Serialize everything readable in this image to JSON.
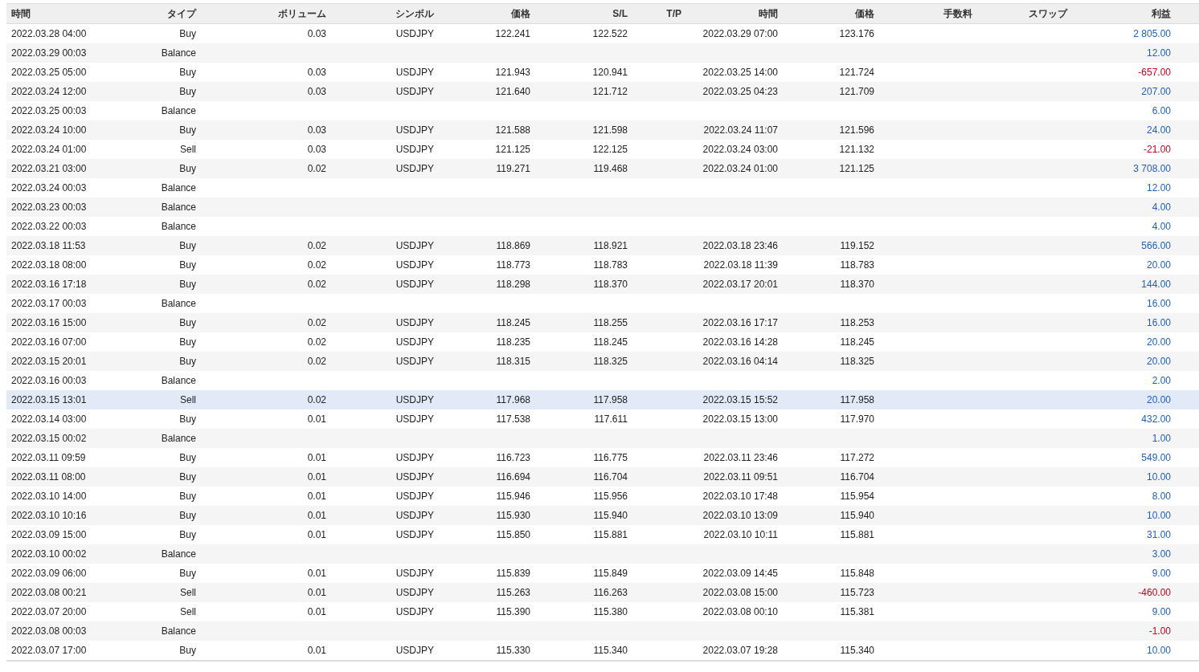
{
  "table": {
    "columns": [
      "時間",
      "タイプ",
      "ボリューム",
      "シンボル",
      "価格",
      "S/L",
      "T/P",
      "時間",
      "価格",
      "手数料",
      "スワップ",
      "利益"
    ],
    "rows": [
      {
        "time": "2022.03.28 04:00",
        "type": "Buy",
        "volume": "0.03",
        "symbol": "USDJPY",
        "price": "122.241",
        "sl": "122.522",
        "close_time": "2022.03.29 07:00",
        "close_price": "123.176",
        "profit": "2 805.00",
        "color": "#1f5fbf",
        "selected": false
      },
      {
        "time": "2022.03.29 00:03",
        "type": "Balance",
        "profit": "12.00",
        "color": "#1f5fbf",
        "selected": false
      },
      {
        "time": "2022.03.25 05:00",
        "type": "Buy",
        "volume": "0.03",
        "symbol": "USDJPY",
        "price": "121.943",
        "sl": "120.941",
        "close_time": "2022.03.25 14:00",
        "close_price": "121.724",
        "profit": "-657.00",
        "color": "#c8001e",
        "selected": false
      },
      {
        "time": "2022.03.24 12:00",
        "type": "Buy",
        "volume": "0.03",
        "symbol": "USDJPY",
        "price": "121.640",
        "sl": "121.712",
        "close_time": "2022.03.25 04:23",
        "close_price": "121.709",
        "profit": "207.00",
        "color": "#1f5fbf",
        "selected": false
      },
      {
        "time": "2022.03.25 00:03",
        "type": "Balance",
        "profit": "6.00",
        "color": "#1f5fbf",
        "selected": false
      },
      {
        "time": "2022.03.24 10:00",
        "type": "Buy",
        "volume": "0.03",
        "symbol": "USDJPY",
        "price": "121.588",
        "sl": "121.598",
        "close_time": "2022.03.24 11:07",
        "close_price": "121.596",
        "profit": "24.00",
        "color": "#1f5fbf",
        "selected": false
      },
      {
        "time": "2022.03.24 01:00",
        "type": "Sell",
        "volume": "0.03",
        "symbol": "USDJPY",
        "price": "121.125",
        "sl": "122.125",
        "close_time": "2022.03.24 03:00",
        "close_price": "121.132",
        "profit": "-21.00",
        "color": "#c8001e",
        "selected": false
      },
      {
        "time": "2022.03.21 03:00",
        "type": "Buy",
        "volume": "0.02",
        "symbol": "USDJPY",
        "price": "119.271",
        "sl": "119.468",
        "close_time": "2022.03.24 01:00",
        "close_price": "121.125",
        "profit": "3 708.00",
        "color": "#1f5fbf",
        "selected": false
      },
      {
        "time": "2022.03.24 00:03",
        "type": "Balance",
        "profit": "12.00",
        "color": "#1f5fbf",
        "selected": false
      },
      {
        "time": "2022.03.23 00:03",
        "type": "Balance",
        "profit": "4.00",
        "color": "#1f5fbf",
        "selected": false
      },
      {
        "time": "2022.03.22 00:03",
        "type": "Balance",
        "profit": "4.00",
        "color": "#1f5fbf",
        "selected": false
      },
      {
        "time": "2022.03.18 11:53",
        "type": "Buy",
        "volume": "0.02",
        "symbol": "USDJPY",
        "price": "118.869",
        "sl": "118.921",
        "close_time": "2022.03.18 23:46",
        "close_price": "119.152",
        "profit": "566.00",
        "color": "#1f5fbf",
        "selected": false
      },
      {
        "time": "2022.03.18 08:00",
        "type": "Buy",
        "volume": "0.02",
        "symbol": "USDJPY",
        "price": "118.773",
        "sl": "118.783",
        "close_time": "2022.03.18 11:39",
        "close_price": "118.783",
        "profit": "20.00",
        "color": "#1f5fbf",
        "selected": false
      },
      {
        "time": "2022.03.16 17:18",
        "type": "Buy",
        "volume": "0.02",
        "symbol": "USDJPY",
        "price": "118.298",
        "sl": "118.370",
        "close_time": "2022.03.17 20:01",
        "close_price": "118.370",
        "profit": "144.00",
        "color": "#1f5fbf",
        "selected": false
      },
      {
        "time": "2022.03.17 00:03",
        "type": "Balance",
        "profit": "16.00",
        "color": "#1f5fbf",
        "selected": false
      },
      {
        "time": "2022.03.16 15:00",
        "type": "Buy",
        "volume": "0.02",
        "symbol": "USDJPY",
        "price": "118.245",
        "sl": "118.255",
        "close_time": "2022.03.16 17:17",
        "close_price": "118.253",
        "profit": "16.00",
        "color": "#1f5fbf",
        "selected": false
      },
      {
        "time": "2022.03.16 07:00",
        "type": "Buy",
        "volume": "0.02",
        "symbol": "USDJPY",
        "price": "118.235",
        "sl": "118.245",
        "close_time": "2022.03.16 14:28",
        "close_price": "118.245",
        "profit": "20.00",
        "color": "#1f5fbf",
        "selected": false
      },
      {
        "time": "2022.03.15 20:01",
        "type": "Buy",
        "volume": "0.02",
        "symbol": "USDJPY",
        "price": "118.315",
        "sl": "118.325",
        "close_time": "2022.03.16 04:14",
        "close_price": "118.325",
        "profit": "20.00",
        "color": "#1f5fbf",
        "selected": false
      },
      {
        "time": "2022.03.16 00:03",
        "type": "Balance",
        "profit": "2.00",
        "color": "#1f5fbf",
        "selected": false
      },
      {
        "time": "2022.03.15 13:01",
        "type": "Sell",
        "volume": "0.02",
        "symbol": "USDJPY",
        "price": "117.968",
        "sl": "117.958",
        "close_time": "2022.03.15 15:52",
        "close_price": "117.958",
        "profit": "20.00",
        "color": "#1f5fbf",
        "selected": true
      },
      {
        "time": "2022.03.14 03:00",
        "type": "Buy",
        "volume": "0.01",
        "symbol": "USDJPY",
        "price": "117.538",
        "sl": "117.611",
        "close_time": "2022.03.15 13:00",
        "close_price": "117.970",
        "profit": "432.00",
        "color": "#1f5fbf",
        "selected": false
      },
      {
        "time": "2022.03.15 00:02",
        "type": "Balance",
        "profit": "1.00",
        "color": "#1f5fbf",
        "selected": false
      },
      {
        "time": "2022.03.11 09:59",
        "type": "Buy",
        "volume": "0.01",
        "symbol": "USDJPY",
        "price": "116.723",
        "sl": "116.775",
        "close_time": "2022.03.11 23:46",
        "close_price": "117.272",
        "profit": "549.00",
        "color": "#1f5fbf",
        "selected": false
      },
      {
        "time": "2022.03.11 08:00",
        "type": "Buy",
        "volume": "0.01",
        "symbol": "USDJPY",
        "price": "116.694",
        "sl": "116.704",
        "close_time": "2022.03.11 09:51",
        "close_price": "116.704",
        "profit": "10.00",
        "color": "#1f5fbf",
        "selected": false
      },
      {
        "time": "2022.03.10 14:00",
        "type": "Buy",
        "volume": "0.01",
        "symbol": "USDJPY",
        "price": "115.946",
        "sl": "115.956",
        "close_time": "2022.03.10 17:48",
        "close_price": "115.954",
        "profit": "8.00",
        "color": "#1f5fbf",
        "selected": false
      },
      {
        "time": "2022.03.10 10:16",
        "type": "Buy",
        "volume": "0.01",
        "symbol": "USDJPY",
        "price": "115.930",
        "sl": "115.940",
        "close_time": "2022.03.10 13:09",
        "close_price": "115.940",
        "profit": "10.00",
        "color": "#1f5fbf",
        "selected": false
      },
      {
        "time": "2022.03.09 15:00",
        "type": "Buy",
        "volume": "0.01",
        "symbol": "USDJPY",
        "price": "115.850",
        "sl": "115.881",
        "close_time": "2022.03.10 10:11",
        "close_price": "115.881",
        "profit": "31.00",
        "color": "#1f5fbf",
        "selected": false
      },
      {
        "time": "2022.03.10 00:02",
        "type": "Balance",
        "profit": "3.00",
        "color": "#1f5fbf",
        "selected": false
      },
      {
        "time": "2022.03.09 06:00",
        "type": "Buy",
        "volume": "0.01",
        "symbol": "USDJPY",
        "price": "115.839",
        "sl": "115.849",
        "close_time": "2022.03.09 14:45",
        "close_price": "115.848",
        "profit": "9.00",
        "color": "#1f5fbf",
        "selected": false
      },
      {
        "time": "2022.03.08 00:21",
        "type": "Sell",
        "volume": "0.01",
        "symbol": "USDJPY",
        "price": "115.263",
        "sl": "116.263",
        "close_time": "2022.03.08 15:00",
        "close_price": "115.723",
        "profit": "-460.00",
        "color": "#c8001e",
        "selected": false
      },
      {
        "time": "2022.03.07 20:00",
        "type": "Sell",
        "volume": "0.01",
        "symbol": "USDJPY",
        "price": "115.390",
        "sl": "115.380",
        "close_time": "2022.03.08 00:10",
        "close_price": "115.381",
        "profit": "9.00",
        "color": "#1f5fbf",
        "selected": false
      },
      {
        "time": "2022.03.08 00:03",
        "type": "Balance",
        "profit": "-1.00",
        "color": "#c8001e",
        "selected": false
      },
      {
        "time": "2022.03.07 17:00",
        "type": "Buy",
        "volume": "0.01",
        "symbol": "USDJPY",
        "price": "115.330",
        "sl": "115.340",
        "close_time": "2022.03.07 19:28",
        "close_price": "115.340",
        "profit": "10.00",
        "color": "#1f5fbf",
        "selected": false
      }
    ]
  }
}
